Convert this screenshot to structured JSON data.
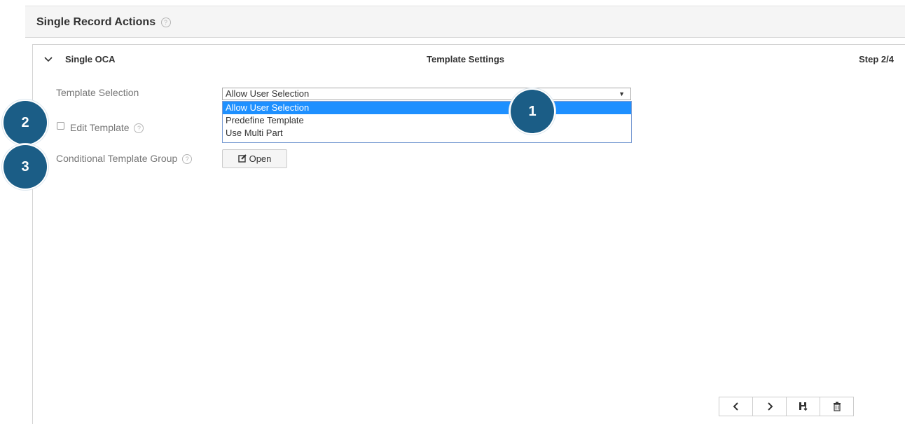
{
  "header": {
    "title": "Single Record Actions",
    "help": "?"
  },
  "panel": {
    "collapse_icon": "chevron-down-icon",
    "title": "Single OCA",
    "center_title": "Template Settings",
    "step": "Step 2/4"
  },
  "template_selection": {
    "label": "Template Selection",
    "selected": "Allow User Selection",
    "options": [
      "Allow User Selection",
      "Predefine Template",
      "Use Multi Part"
    ]
  },
  "edit_template": {
    "label": "Edit Template",
    "checked": false,
    "help": "?"
  },
  "conditional_group": {
    "label": "Conditional Template Group",
    "help": "?",
    "button_label": "Open",
    "button_icon": "edit-icon"
  },
  "badges": [
    "1",
    "2",
    "3"
  ],
  "nav": {
    "prev_icon": "chevron-left-icon",
    "next_icon": "chevron-right-icon",
    "save_icon": "save-icon",
    "delete_icon": "trash-icon"
  },
  "colors": {
    "badge": "#1b5d86",
    "selected_option": "#1e90ff"
  }
}
